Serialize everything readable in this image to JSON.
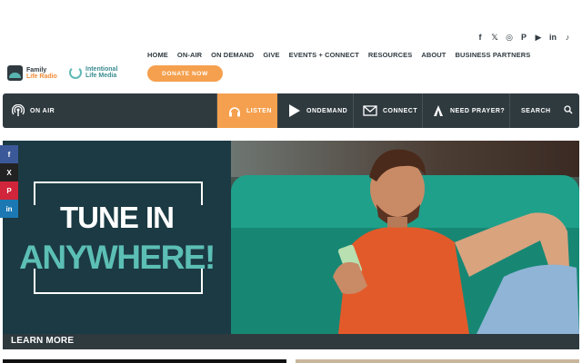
{
  "social": [
    "f",
    "𝕏",
    "◎",
    "P",
    "▶",
    "in",
    "♪"
  ],
  "menu": [
    "HOME",
    "ON-AIR",
    "ON DEMAND",
    "GIVE",
    "EVENTS + CONNECT",
    "RESOURCES",
    "ABOUT",
    "BUSINESS PARTNERS"
  ],
  "logos": {
    "family_line1": "Family",
    "family_line2": "Life Radio",
    "intentional_line1": "Intentional",
    "intentional_line2": "Life Media"
  },
  "donate_label": "DONATE NOW",
  "nav": {
    "on_air": "ON AIR",
    "listen": "LISTEN",
    "ondemand": "ONDEMAND",
    "connect": "CONNECT",
    "need_prayer": "NEED PRAYER?",
    "search": "SEARCH"
  },
  "share": [
    "f",
    "X",
    "P",
    "in"
  ],
  "hero": {
    "line1": "TUNE IN",
    "line2": "ANYWHERE!",
    "learn_more": "LEARN MORE"
  },
  "colors": {
    "accent": "#f5a04e",
    "nav_bg": "#2f3a3f",
    "teal": "#5cbfb6",
    "facebook": "#3b5998",
    "x": "#222222",
    "pinterest": "#d0253a",
    "linkedin": "#1b78b3"
  }
}
